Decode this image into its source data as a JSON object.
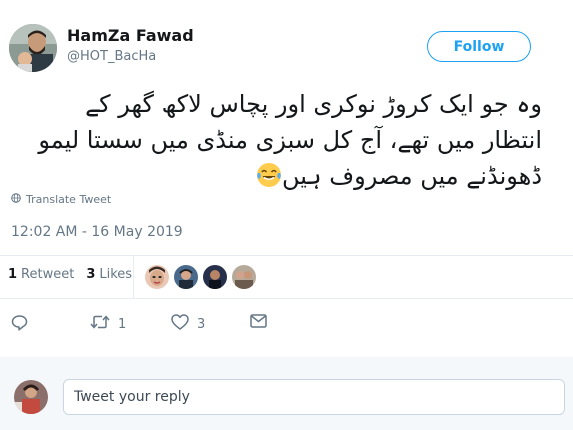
{
  "user": {
    "display_name": "HamZa Fawad",
    "handle": "@HOT_BacHa",
    "follow_label": "Follow"
  },
  "tweet": {
    "lines": [
      "وہ جو ایک کروڑ نوکری اور پچاس لاکھ گھر کے",
      "انتظار میں تھے، آج کل سبزی منڈی میں سستا لیمو",
      "ڈھونڈنے میں مصروف ہیں"
    ],
    "emoji": "face-with-tears-of-joy",
    "translate_label": "Translate Tweet",
    "timestamp": "12:02 AM - 16 May 2019"
  },
  "stats": {
    "retweets_count": "1",
    "retweets_label": "Retweet",
    "likes_count": "3",
    "likes_label": "Likes"
  },
  "actions": {
    "reply_count": "",
    "retweet_count": "1",
    "like_count": "3"
  },
  "composer": {
    "placeholder": "Tweet your reply"
  },
  "colors": {
    "accent": "#1da1f2",
    "muted": "#657786",
    "text": "#14171a",
    "divider": "#e6ecf0",
    "composer_bg": "#f5f8fa"
  }
}
